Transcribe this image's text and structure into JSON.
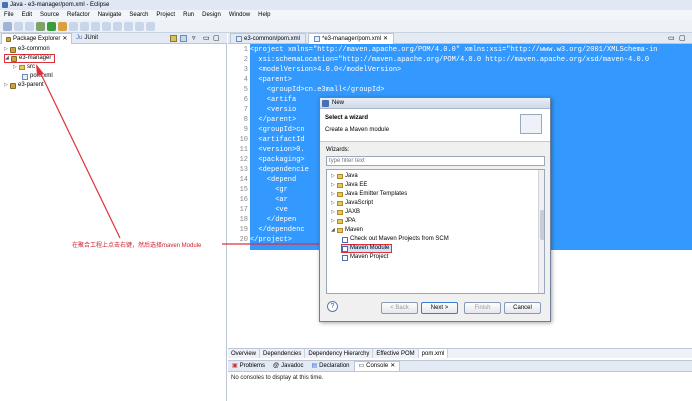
{
  "window": {
    "title": "Java - e3-manager/pom.xml - Eclipse"
  },
  "menu": [
    "File",
    "Edit",
    "Source",
    "Refactor",
    "Navigate",
    "Search",
    "Project",
    "Run",
    "Design",
    "Window",
    "Help"
  ],
  "left_panel": {
    "tabs": [
      "Package Explorer",
      "JUnit"
    ],
    "tree": [
      {
        "label": "e3-common",
        "expanded": false
      },
      {
        "label": "e3-manager",
        "expanded": true
      },
      {
        "label": "src",
        "expanded": false
      },
      {
        "label": "pom.xml",
        "expanded": null
      },
      {
        "label": "e3-parent",
        "expanded": false
      }
    ]
  },
  "annotation": {
    "text": "在聚合工程上点击右键，然后选择maven Module",
    "color": "#d02030"
  },
  "editor": {
    "tabs": [
      "e3-common/pom.xml",
      "*e3-manager/pom.xml"
    ],
    "line_numbers": [
      "1",
      "2",
      "3",
      "4",
      "5",
      "6",
      "7",
      "8",
      "9",
      "10",
      "11",
      "12",
      "13",
      "14",
      "15",
      "16",
      "17",
      "18",
      "19",
      "20"
    ],
    "lines": [
      "<project xmlns=\"http://maven.apache.org/POM/4.0.0\" xmlns:xsi=\"http://www.w3.org/2001/XMLSchema-in",
      "  xsi:schemaLocation=\"http://maven.apache.org/POM/4.0.0 http://maven.apache.org/xsd/maven-4.0.0",
      "  <modelVersion>4.0.0</modelVersion>",
      "  <parent>",
      "    <groupId>cn.e3mall</groupId>",
      "    <artifa",
      "    <versio",
      "  </parent>",
      "  <groupId>cn",
      "  <artifactId",
      "  <version>0.",
      "  <packaging>",
      "  <dependencie",
      "    <depend",
      "      <gr",
      "      <ar",
      "      <ve",
      "    </depen",
      "  </dependenc",
      "</project>"
    ],
    "selection_color": "#3399ff",
    "pom_tabs": [
      "Overview",
      "Dependencies",
      "Dependency Hierarchy",
      "Effective POM",
      "pom.xml"
    ]
  },
  "console_panel": {
    "tabs": [
      "Problems",
      "Javadoc",
      "Declaration",
      "Console"
    ],
    "message": "No consoles to display at this time."
  },
  "dialog": {
    "title": "New",
    "heading": "Select a wizard",
    "description": "Create a Maven module",
    "wizards_label": "Wizards:",
    "filter_placeholder": "type filter text",
    "items": [
      {
        "label": "Java",
        "type": "folder"
      },
      {
        "label": "Java EE",
        "type": "folder"
      },
      {
        "label": "Java Emitter Templates",
        "type": "folder"
      },
      {
        "label": "JavaScript",
        "type": "folder"
      },
      {
        "label": "JAXB",
        "type": "folder"
      },
      {
        "label": "JPA",
        "type": "folder"
      },
      {
        "label": "Maven",
        "type": "folder"
      },
      {
        "label": "Check out Maven Projects from SCM",
        "type": "item"
      },
      {
        "label": "Maven Module",
        "type": "item",
        "selected": true
      },
      {
        "label": "Maven Project",
        "type": "item"
      }
    ],
    "buttons": {
      "back": "< Back",
      "next": "Next >",
      "finish": "Finish",
      "cancel": "Cancel"
    },
    "help": "?"
  }
}
